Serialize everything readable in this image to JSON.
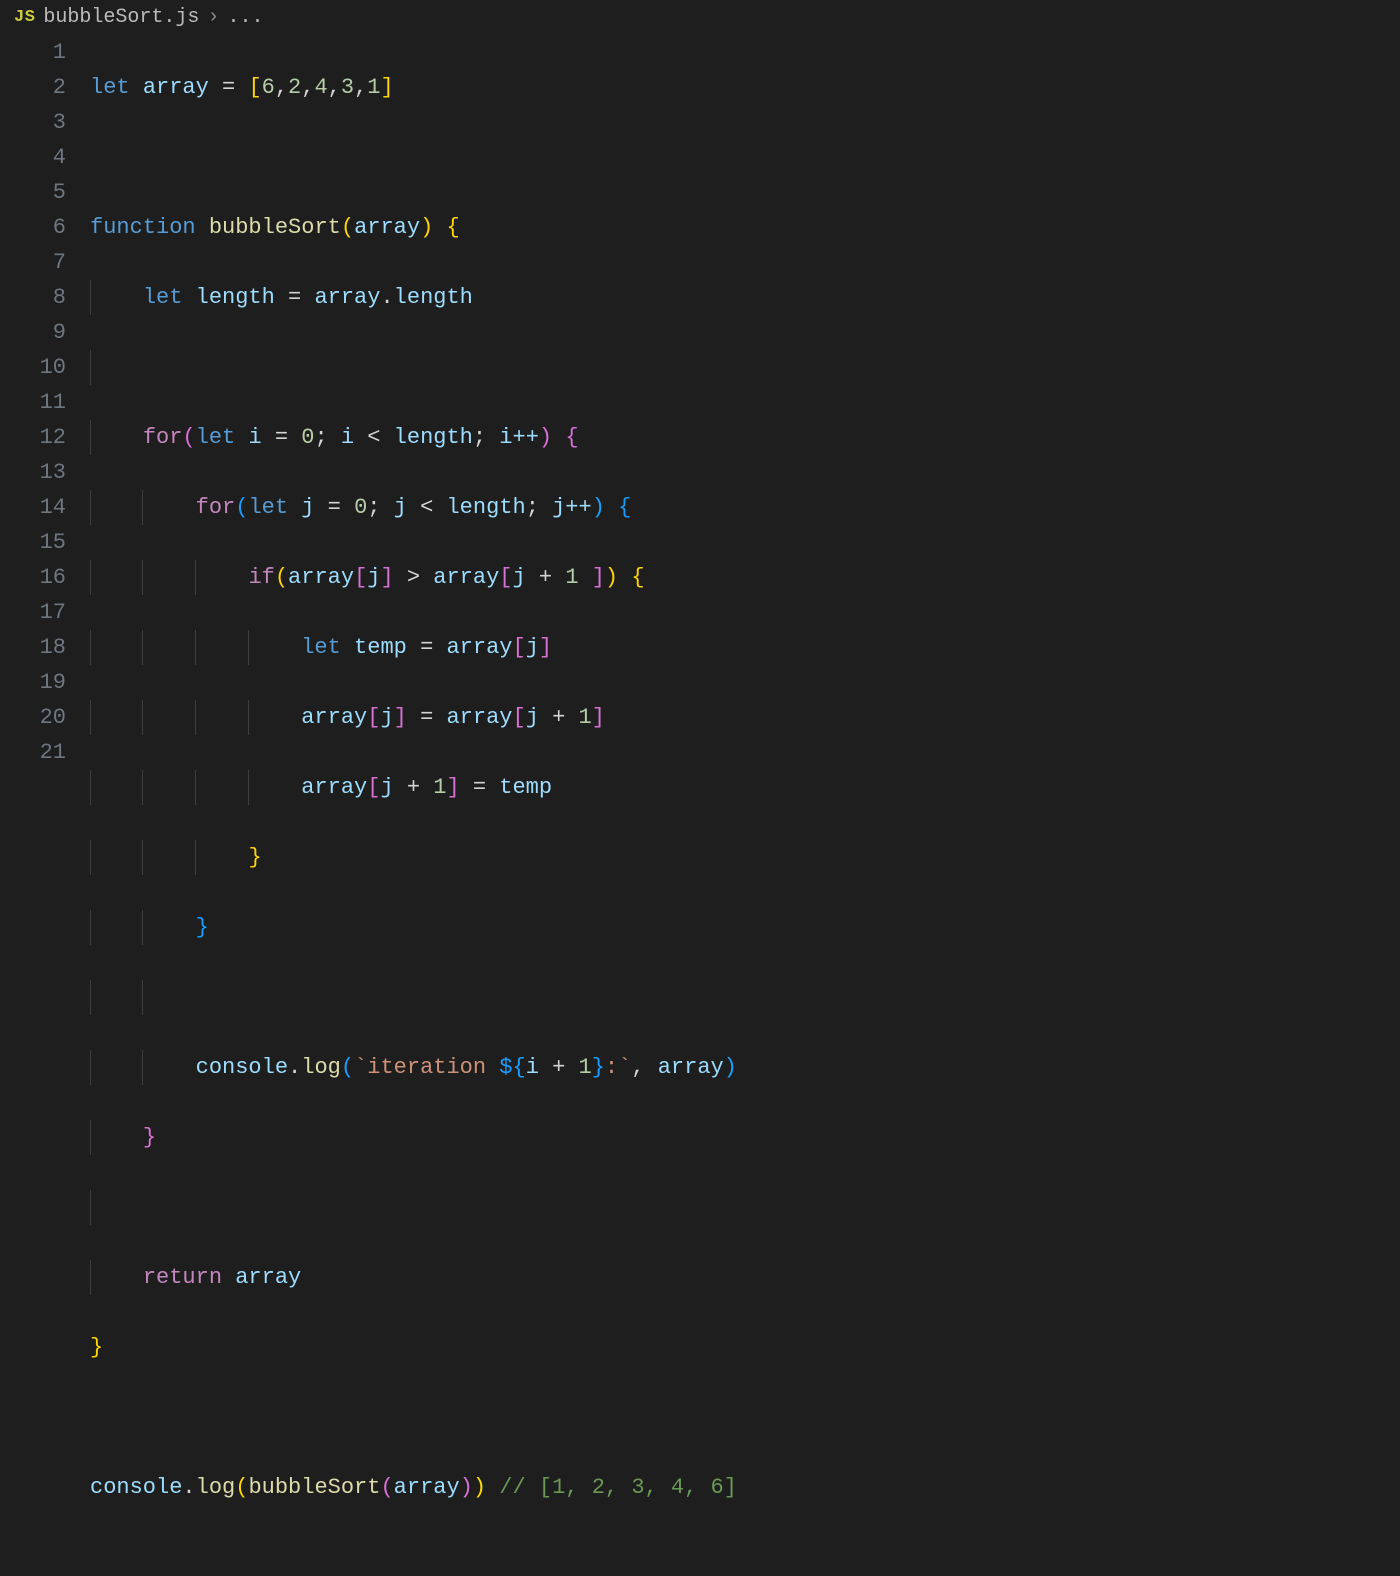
{
  "breadcrumb": {
    "badge": "JS",
    "filename": "bubbleSort.js",
    "separator": "›",
    "tail": "..."
  },
  "line_numbers": [
    "1",
    "2",
    "3",
    "4",
    "5",
    "6",
    "7",
    "8",
    "9",
    "10",
    "11",
    "12",
    "13",
    "14",
    "15",
    "16",
    "17",
    "18",
    "19",
    "20",
    "21"
  ],
  "code": {
    "l1": {
      "kw": "let",
      "var": "array",
      "op": "=",
      "arr": "[6,2,4,3,1]"
    },
    "l3": {
      "kw": "function",
      "fn": "bubbleSort",
      "param": "array"
    },
    "l4": {
      "kw": "let",
      "var": "length",
      "op": "=",
      "expr_obj": "array",
      "expr_prop": "length"
    },
    "l6": {
      "kw": "for",
      "kw2": "let",
      "var": "i",
      "init": "0",
      "cond_var": "i",
      "cond_op": "<",
      "cond_rhs": "length",
      "inc": "i++"
    },
    "l7": {
      "kw": "for",
      "kw2": "let",
      "var": "j",
      "init": "0",
      "cond_var": "j",
      "cond_op": "<",
      "cond_rhs": "length",
      "inc": "j++"
    },
    "l8": {
      "kw": "if",
      "lhs_obj": "array",
      "lhs_idx": "j",
      "op": ">",
      "rhs_obj": "array",
      "rhs_idx_j": "j",
      "rhs_plus": "+",
      "rhs_one": "1"
    },
    "l9": {
      "kw": "let",
      "var": "temp",
      "op": "=",
      "rhs_obj": "array",
      "rhs_idx": "j"
    },
    "l10": {
      "lhs_obj": "array",
      "lhs_idx": "j",
      "op": "=",
      "rhs_obj": "array",
      "rhs_idx_j": "j",
      "rhs_plus": "+",
      "rhs_one": "1"
    },
    "l11": {
      "lhs_obj": "array",
      "lhs_idx_j": "j",
      "lhs_plus": "+",
      "lhs_one": "1",
      "op": "=",
      "rhs": "temp"
    },
    "l15": {
      "obj": "console",
      "method": "log",
      "tmpl_pre": "`iteration ",
      "tmpl_expr_i": "i",
      "tmpl_plus": "+",
      "tmpl_one": "1",
      "tmpl_post": ":`",
      "arg2": "array"
    },
    "l18": {
      "kw": "return",
      "var": "array"
    },
    "l21": {
      "obj": "console",
      "method": "log",
      "fn": "bubbleSort",
      "arg": "array",
      "comment": "// [1, 2, 3, 4, 6]"
    }
  }
}
